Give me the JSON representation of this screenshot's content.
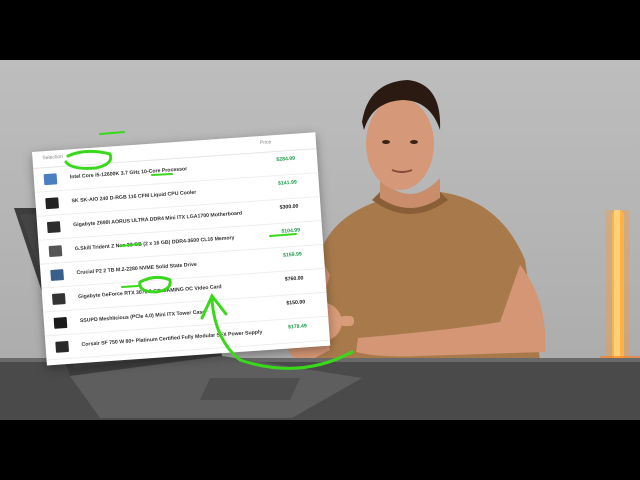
{
  "video_frame": {
    "description_elements": [
      "laptop",
      "person-in-brown-tshirt",
      "tube-light",
      "parts-list-card"
    ],
    "colors": {
      "annotation_green": "#3ad81c",
      "price_green": "#1e9e4a",
      "tube_light": "#ff8a1c"
    }
  },
  "parts_list": {
    "header_selection": "Selection",
    "header_price": "Price",
    "rows": [
      {
        "name": "Intel Core i5-12600K 3.7 GHz 10-Core Processor",
        "price": "$284.99",
        "price_style": "green",
        "thumb_color": "#4a7fc1"
      },
      {
        "name": "SK SK-AIO 240 D-RGB 116 CFM Liquid CPU Cooler",
        "price": "$141.99",
        "price_style": "green",
        "thumb_color": "#222222"
      },
      {
        "name": "Gigabyte Z690I AORUS ULTRA DDR4 Mini ITX LGA1700 Motherboard",
        "price": "$300.00",
        "price_style": "black",
        "thumb_color": "#2c2c2c"
      },
      {
        "name": "G.Skill Trident Z Neo 32 GB (2 x 16 GB) DDR4-3600 CL16 Memory",
        "price": "$104.99",
        "price_style": "green",
        "thumb_color": "#555555"
      },
      {
        "name": "Crucial P2 2 TB M.2-2280 NVME Solid State Drive",
        "price": "$159.99",
        "price_style": "green",
        "thumb_color": "#3a5f8a"
      },
      {
        "name": "Gigabyte GeForce RTX 3070 8 GB GAMING OC Video Card",
        "price": "$760.00",
        "price_style": "black",
        "thumb_color": "#333333"
      },
      {
        "name": "SSUPD Meshlicious (PCIe 4.0) Mini ITX Tower Case",
        "price": "$150.00",
        "price_style": "black",
        "thumb_color": "#1a1a1a"
      },
      {
        "name": "Corsair SF 750 W 80+ Platinum Certified Fully Modular SFX Power Supply",
        "price": "$178.49",
        "price_style": "green",
        "thumb_color": "#2a2a2a"
      }
    ]
  }
}
